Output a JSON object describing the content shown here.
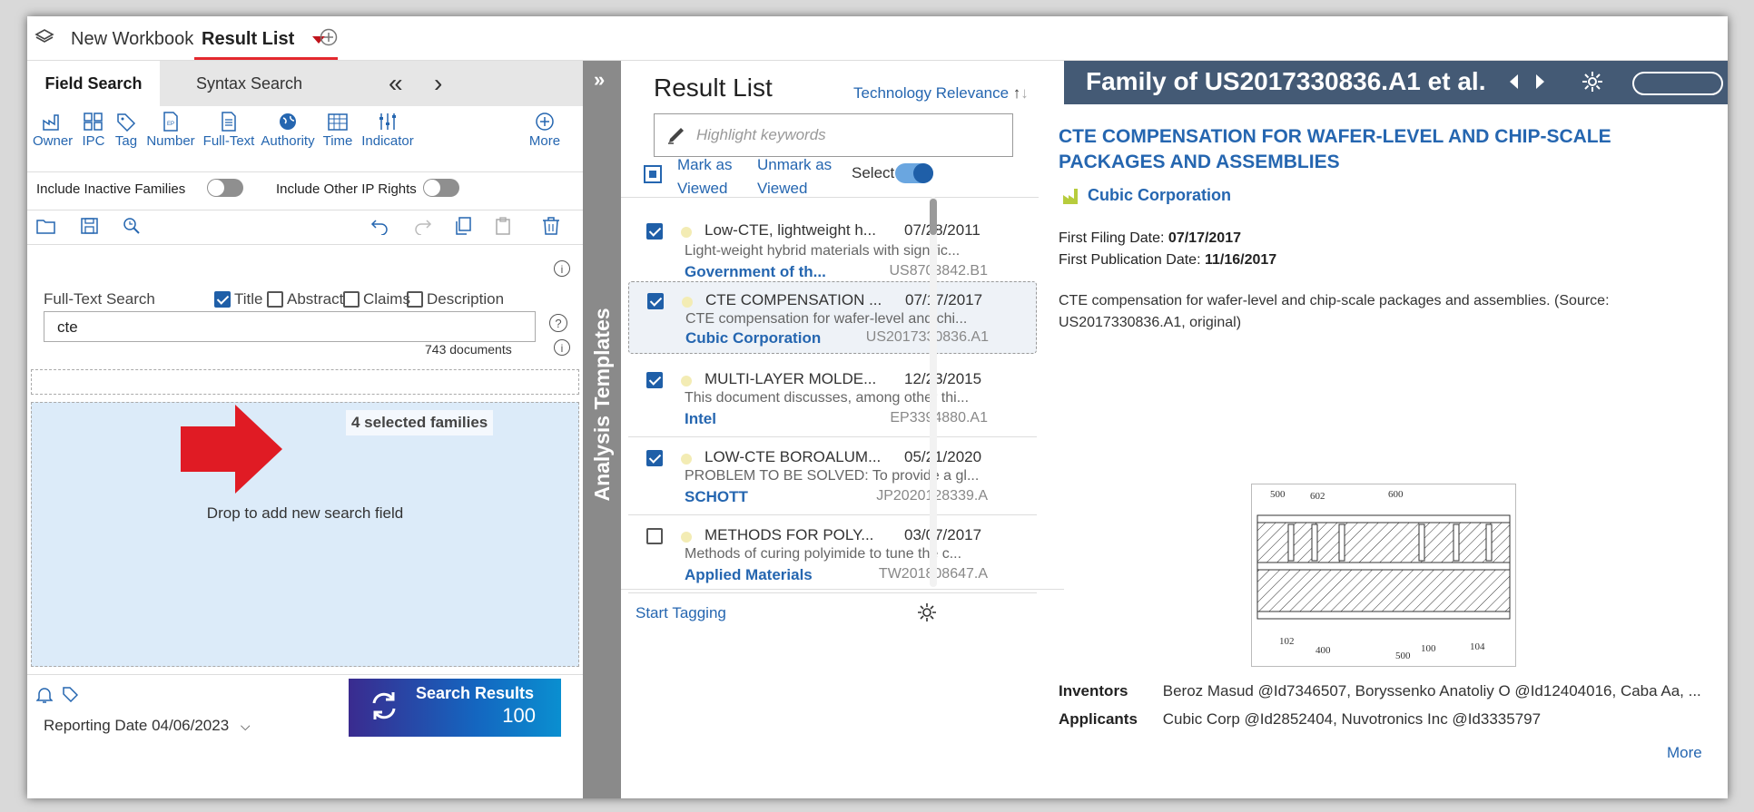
{
  "top_tabs": {
    "workbook_label": "New Workbook",
    "result_list_label": "Result List"
  },
  "left_panel": {
    "tabs": {
      "field_search": "Field Search",
      "syntax_search": "Syntax Search"
    },
    "tools": [
      "Owner",
      "IPC",
      "Tag",
      "Number",
      "Full-Text",
      "Authority",
      "Time",
      "Indicator",
      "More"
    ],
    "toggles": {
      "inactive_families": "Include Inactive Families",
      "other_ip_rights": "Include Other IP Rights"
    },
    "fulltext": {
      "label": "Full-Text Search",
      "options": {
        "title": "Title",
        "abstract": "Abstract",
        "claims": "Claims",
        "description": "Description"
      },
      "query": "cte",
      "doc_count": "743 documents"
    },
    "dropzone": {
      "badge": "4 selected families",
      "text": "Drop to add new search field"
    },
    "footer": {
      "reporting_label": "Reporting Date",
      "reporting_date": "04/06/2023",
      "search_button": "Search Results",
      "search_count": "100"
    }
  },
  "analysis_templates": {
    "label": "Analysis Templates",
    "expand": "»"
  },
  "result_list": {
    "title": "Result List",
    "sort_label": "Technology Relevance",
    "highlight_placeholder": "Highlight keywords",
    "mark_viewed": "Mark as Viewed",
    "unmark_viewed": "Unmark as Viewed",
    "select_label": "Select",
    "items": [
      {
        "title": "Low-CTE, lightweight h...",
        "date": "07/28/2011",
        "desc": "Light-weight hybrid materials with signific...",
        "owner": "Government of th...",
        "number": "US8703842.B1",
        "checked": true
      },
      {
        "title": "CTE COMPENSATION ...",
        "date": "07/17/2017",
        "desc": "CTE compensation for wafer-level and chi...",
        "owner": "Cubic Corporation",
        "number": "US2017330836.A1",
        "checked": true
      },
      {
        "title": "MULTI-LAYER MOLDE...",
        "date": "12/23/2015",
        "desc": "This document discusses, among other thi...",
        "owner": "Intel",
        "number": "EP3394880.A1",
        "checked": true
      },
      {
        "title": "LOW-CTE BOROALUM...",
        "date": "05/21/2020",
        "desc": "PROBLEM TO BE SOLVED: To provide a gl...",
        "owner": "SCHOTT",
        "number": "JP2020128339.A",
        "checked": true
      },
      {
        "title": "METHODS FOR POLY...",
        "date": "03/07/2017",
        "desc": "Methods of curing polyimide to tune the c...",
        "owner": "Applied Materials",
        "number": "TW201808647.A",
        "checked": false
      }
    ],
    "start_tagging": "Start Tagging"
  },
  "detail": {
    "header": "Family of US2017330836.A1 et al.",
    "title": "CTE COMPENSATION FOR WAFER-LEVEL AND CHIP-SCALE PACKAGES AND ASSEMBLIES",
    "company": "Cubic Corporation",
    "first_filing_label": "First Filing Date:",
    "first_filing": "07/17/2017",
    "first_pub_label": "First Publication Date:",
    "first_pub": "11/16/2017",
    "abstract": "CTE compensation for wafer-level and chip-scale packages and assemblies. (Source: US2017330836.A1, original)",
    "drawing_labels": [
      "500",
      "602",
      "600",
      "102",
      "400",
      "500",
      "100",
      "104"
    ],
    "inventors_label": "Inventors",
    "inventors": "Beroz Masud @Id7346507, Boryssenko Anatoliy O @Id12404016, Caba Aa, ...",
    "applicants_label": "Applicants",
    "applicants": "Cubic Corp @Id2852404, Nuvotronics Inc @Id3335797",
    "more": "More"
  },
  "colors": {
    "accent": "#2566b0",
    "header_bg": "#445a75",
    "active_tab_underline": "#e4282e",
    "dropzone_bg": "#dcebf9",
    "arrow": "#e01b24"
  }
}
